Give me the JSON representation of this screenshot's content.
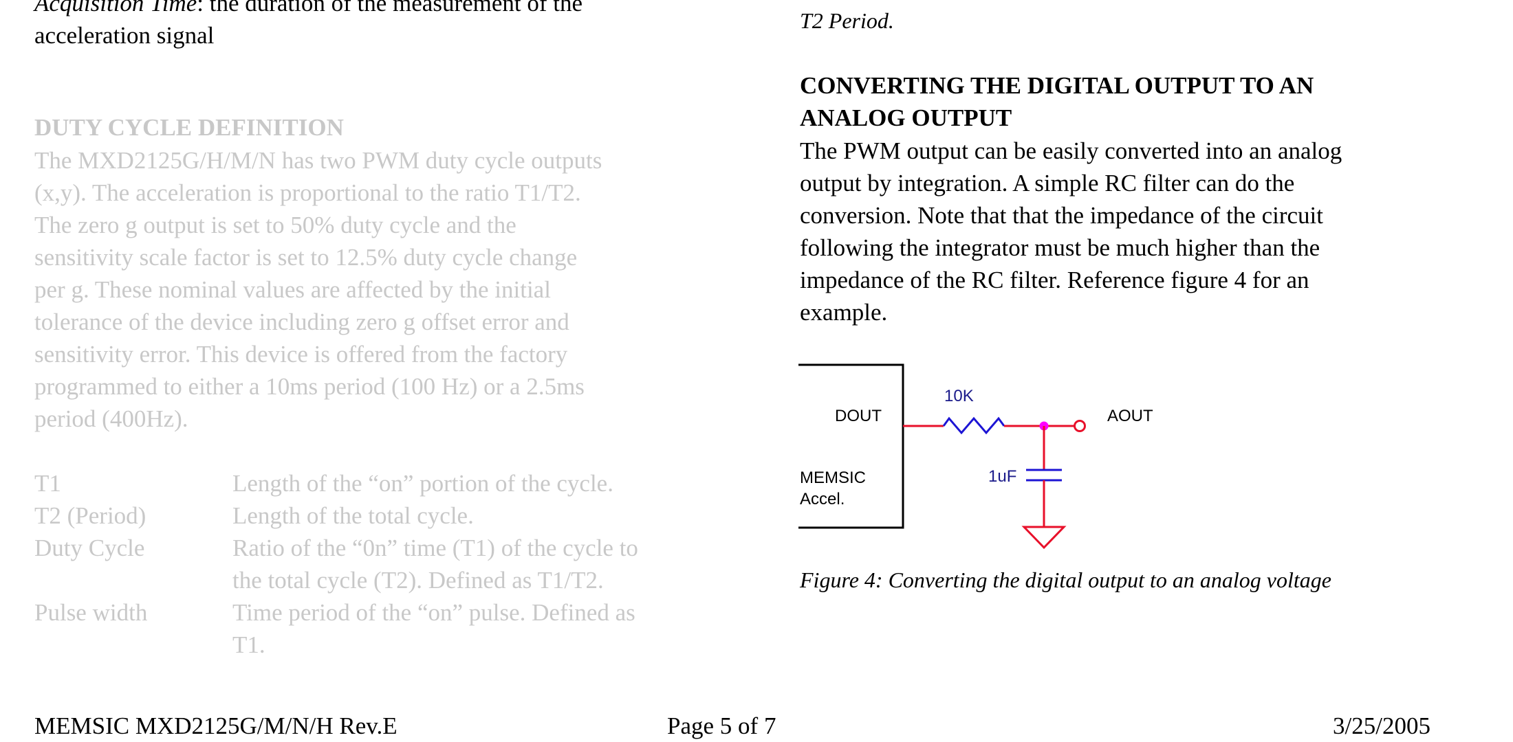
{
  "left_column": {
    "top_fragment": {
      "term": "Acquisition Time",
      "text_line1": ": the duration of the measurement of the",
      "text_line2": "acceleration signal"
    },
    "duty_cycle_heading": "DUTY CYCLE DEFINITION",
    "duty_cycle_paragraph": [
      "The MXD2125G/H/M/N has two PWM duty cycle outputs",
      "(x,y). The acceleration is proportional to the ratio T1/T2.",
      "The zero g output is set to 50% duty cycle and the",
      "sensitivity scale factor is set to 12.5% duty cycle change",
      "per g.  These nominal values are affected by the initial",
      "tolerance of the device including zero g offset error and",
      "sensitivity error.  This device is offered from the factory",
      "programmed to either a 10ms period (100 Hz) or a 2.5ms",
      "period (400Hz)."
    ],
    "definitions": [
      {
        "term": "T1",
        "desc": [
          "Length of the “on” portion of the cycle."
        ]
      },
      {
        "term": "T2 (Period)",
        "desc": [
          "Length of the total cycle."
        ]
      },
      {
        "term": "Duty Cycle",
        "desc": [
          "Ratio of the “0n” time (T1) of the cycle to",
          "the total cycle (T2). Defined as T1/T2."
        ]
      },
      {
        "term": "Pulse width",
        "desc": [
          "Time period of the “on” pulse. Defined as",
          "T1."
        ]
      }
    ]
  },
  "right_column": {
    "top_fragment": "T2 Period.",
    "heading": [
      "CONVERTING THE DIGITAL OUTPUT TO AN",
      "ANALOG OUTPUT"
    ],
    "paragraph": [
      "The PWM output can be easily converted into an analog",
      "output by integration. A simple RC filter can do the",
      "conversion. Note that that the impedance of the circuit",
      "following the integrator must be much higher than the",
      "impedance of the RC filter. Reference figure 4 for an",
      "example."
    ],
    "figure": {
      "labels": {
        "dout": "DOUT",
        "device_line1": "MEMSIC",
        "device_line2": "Accel.",
        "resistor": "10K",
        "capacitor": "1uF",
        "aout": "AOUT"
      },
      "colors": {
        "wire": "#e8102a",
        "component": "#1c14d4",
        "junction": "#ff00ff",
        "value_label": "#1a1a8a",
        "box": "#000000"
      },
      "caption": "Figure 4:  Converting the digital output to an analog voltage"
    }
  },
  "footer": {
    "left": "MEMSIC MXD2125G/M/N/H Rev.E",
    "center": "Page 5 of 7",
    "right": "3/25/2005"
  },
  "colors": {
    "text": "#000000",
    "faded_text": "#c8c8c8"
  }
}
